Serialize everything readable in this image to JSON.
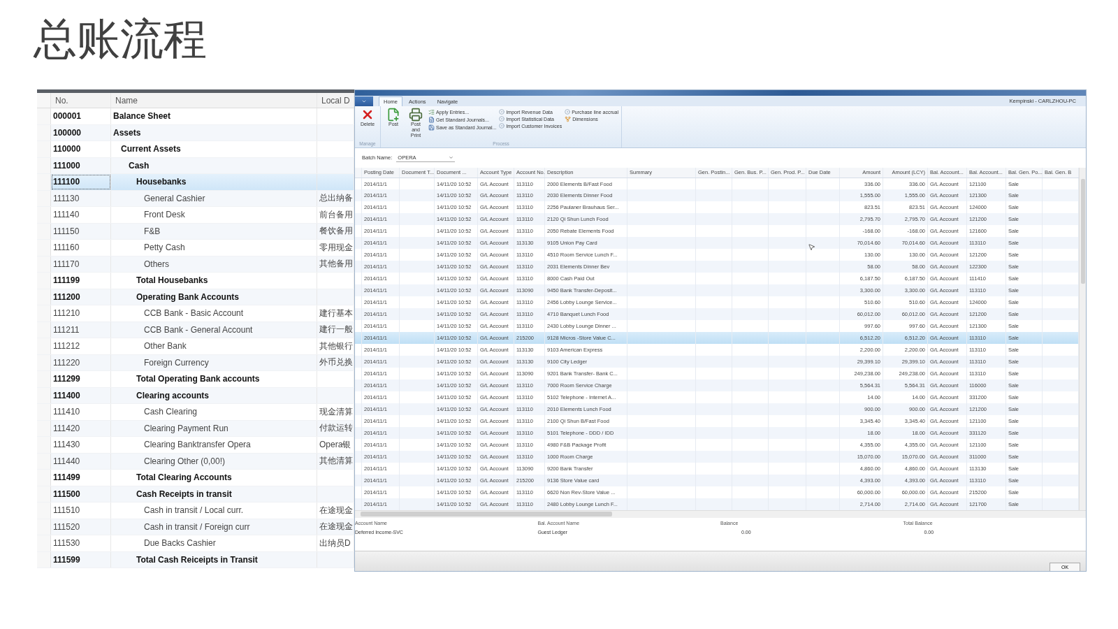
{
  "slide_title": "总账流程",
  "ledger": {
    "columns": [
      "No.",
      "Name",
      "Local D"
    ],
    "accounts": [
      {
        "no": "000001",
        "name": "Balance Sheet",
        "kind": "heading",
        "selected": false
      },
      {
        "no": "100000",
        "name": "Assets",
        "kind": "heading",
        "selected": false,
        "children": [
          {
            "no": "110000",
            "name": "Current Assets",
            "kind": "heading",
            "selected": false,
            "children": [
              {
                "no": "111000",
                "name": "Cash",
                "kind": "heading",
                "selected": false,
                "children": [
                  {
                    "no": "111100",
                    "name": "Housebanks",
                    "kind": "heading",
                    "selected": true,
                    "children": [
                      {
                        "no": "111130",
                        "name": "General Cashier",
                        "local": "总出纳备",
                        "kind": "account",
                        "selected": false
                      },
                      {
                        "no": "111140",
                        "name": "Front Desk",
                        "local": "前台备用",
                        "kind": "account",
                        "selected": false
                      },
                      {
                        "no": "111150",
                        "name": "F&B",
                        "local": "餐饮备用",
                        "kind": "account",
                        "selected": false
                      },
                      {
                        "no": "111160",
                        "name": "Petty Cash",
                        "local": "零用现金",
                        "kind": "account",
                        "selected": false
                      },
                      {
                        "no": "111170",
                        "name": "Others",
                        "local": "其他备用",
                        "kind": "account",
                        "selected": false
                      }
                    ]
                  },
                  {
                    "no": "111199",
                    "name": "Total Housebanks",
                    "kind": "heading",
                    "selected": false
                  },
                  {
                    "no": "111200",
                    "name": "Operating Bank Accounts",
                    "kind": "heading",
                    "selected": false,
                    "children": [
                      {
                        "no": "111210",
                        "name": "CCB Bank - Basic Account",
                        "local": "建行基本",
                        "kind": "account",
                        "selected": false
                      },
                      {
                        "no": "111211",
                        "name": "CCB Bank - General Account",
                        "local": "建行一般",
                        "kind": "account",
                        "selected": false
                      },
                      {
                        "no": "111212",
                        "name": "Other Bank",
                        "local": "其他银行",
                        "kind": "account",
                        "selected": false
                      },
                      {
                        "no": "111220",
                        "name": "Foreign Currency",
                        "local": "外币兑换",
                        "kind": "account",
                        "selected": false
                      }
                    ]
                  },
                  {
                    "no": "111299",
                    "name": "Total Operating Bank accounts",
                    "kind": "heading",
                    "selected": false
                  },
                  {
                    "no": "111400",
                    "name": "Clearing accounts",
                    "kind": "heading",
                    "selected": false,
                    "children": [
                      {
                        "no": "111410",
                        "name": "Cash Clearing",
                        "local": "现金清算",
                        "kind": "account",
                        "selected": false
                      },
                      {
                        "no": "111420",
                        "name": "Clearing Payment Run",
                        "local": "付款运转",
                        "kind": "account",
                        "selected": false
                      },
                      {
                        "no": "111430",
                        "name": "Clearing Banktransfer Opera",
                        "local": "Opera银",
                        "kind": "account",
                        "selected": false
                      },
                      {
                        "no": "111440",
                        "name": "Clearing Other (0,00!)",
                        "local": "其他清算",
                        "kind": "account",
                        "selected": false
                      }
                    ]
                  },
                  {
                    "no": "111499",
                    "name": "Total Clearing Accounts",
                    "kind": "heading",
                    "selected": false
                  },
                  {
                    "no": "111500",
                    "name": "Cash Receipts in transit",
                    "kind": "heading",
                    "selected": false,
                    "children": [
                      {
                        "no": "111510",
                        "name": "Cash in transit / Local curr.",
                        "local": "在途现金",
                        "kind": "account",
                        "selected": false
                      },
                      {
                        "no": "111520",
                        "name": "Cash in transit / Foreign curr",
                        "local": "在途现金",
                        "kind": "account",
                        "selected": false
                      },
                      {
                        "no": "111530",
                        "name": "Due Backs Cashier",
                        "local": "出纳员D",
                        "kind": "account",
                        "selected": false
                      }
                    ]
                  },
                  {
                    "no": "111599",
                    "name": "Total Cash Reiceipts in Transit",
                    "kind": "heading",
                    "selected": false
                  }
                ]
              }
            ]
          }
        ]
      }
    ]
  },
  "journal": {
    "user": "Kempinski - CARLZHOU-PC",
    "tabs": [
      {
        "label": "Home",
        "selected": true
      },
      {
        "label": "Actions",
        "selected": false
      },
      {
        "label": "Navigate",
        "selected": false
      }
    ],
    "groups": [
      {
        "title": "Manage",
        "large": [
          {
            "label": "Delete",
            "kind": "delete"
          }
        ]
      },
      {
        "title": "Process",
        "large": [
          {
            "label": "Post",
            "kind": "post"
          },
          {
            "label": "Post and Print",
            "kind": "print"
          }
        ],
        "columns": [
          [
            {
              "label": "Apply Entries...",
              "kind": "apply"
            },
            {
              "label": "Get Standard Journals...",
              "kind": "journal"
            },
            {
              "label": "Save as Standard Journal...",
              "kind": "save"
            }
          ],
          [
            {
              "label": "Import Revenue Data",
              "kind": "import"
            },
            {
              "label": "Import Statistical Data",
              "kind": "import"
            },
            {
              "label": "Import Customer Invoices",
              "kind": "import"
            }
          ],
          [
            {
              "label": "Purchase line accrual",
              "kind": "import"
            },
            {
              "label": "Dimensions",
              "kind": "dimensions"
            }
          ]
        ]
      }
    ],
    "batch": {
      "label": "Batch Name:",
      "value": "OPERA"
    },
    "grid": {
      "columns": [
        "Posting Date",
        "Document T...",
        "Document ...",
        "Account Type",
        "Account No.",
        "Description",
        "Summary",
        "Gen. Postin...",
        "Gen. Bus. P...",
        "Gen. Prod. P...",
        "Due Date",
        "Amount",
        "Amount (LCY)",
        "Bal. Account...",
        "Bal. Account...",
        "Bal. Gen. Po...",
        "Bal. Gen. B"
      ],
      "rows": [
        {
          "selected": false,
          "posting_date": "2014/11/1",
          "document_date": "14/11/20 10:52",
          "account_type": "G/L Account",
          "account_no": "113110",
          "description": "2000 Elements B/Fast Food",
          "amount": "336.00",
          "amount_lcy": "336.00",
          "bal_account_type": "G/L Account",
          "bal_account_no": "121100",
          "bal_gen_posting": "Sale"
        },
        {
          "selected": false,
          "posting_date": "2014/11/1",
          "document_date": "14/11/20 10:52",
          "account_type": "G/L Account",
          "account_no": "113110",
          "description": "2030 Elements Dinner Food",
          "amount": "1,555.00",
          "amount_lcy": "1,555.00",
          "bal_account_type": "G/L Account",
          "bal_account_no": "121300",
          "bal_gen_posting": "Sale"
        },
        {
          "selected": false,
          "posting_date": "2014/11/1",
          "document_date": "14/11/20 10:52",
          "account_type": "G/L Account",
          "account_no": "113110",
          "description": "2256 Paulaner Brauhaus Ser...",
          "amount": "823.51",
          "amount_lcy": "823.51",
          "bal_account_type": "G/L Account",
          "bal_account_no": "124000",
          "bal_gen_posting": "Sale"
        },
        {
          "selected": false,
          "posting_date": "2014/11/1",
          "document_date": "14/11/20 10:52",
          "account_type": "G/L Account",
          "account_no": "113110",
          "description": "2120 Qi Shun Lunch Food",
          "amount": "2,795.70",
          "amount_lcy": "2,795.70",
          "bal_account_type": "G/L Account",
          "bal_account_no": "121200",
          "bal_gen_posting": "Sale"
        },
        {
          "selected": false,
          "posting_date": "2014/11/1",
          "document_date": "14/11/20 10:52",
          "account_type": "G/L Account",
          "account_no": "113110",
          "description": "2050 Rebate Elements Food",
          "amount": "-168.00",
          "amount_lcy": "-168.00",
          "bal_account_type": "G/L Account",
          "bal_account_no": "121600",
          "bal_gen_posting": "Sale"
        },
        {
          "selected": false,
          "posting_date": "2014/11/1",
          "document_date": "14/11/20 10:52",
          "account_type": "G/L Account",
          "account_no": "113130",
          "description": "9105 Union Pay Card",
          "amount": "70,014.60",
          "amount_lcy": "70,014.60",
          "bal_account_type": "G/L Account",
          "bal_account_no": "113110",
          "bal_gen_posting": "Sale"
        },
        {
          "selected": false,
          "posting_date": "2014/11/1",
          "document_date": "14/11/20 10:52",
          "account_type": "G/L Account",
          "account_no": "113110",
          "description": "4510 Room Service Lunch F...",
          "amount": "130.00",
          "amount_lcy": "130.00",
          "bal_account_type": "G/L Account",
          "bal_account_no": "121200",
          "bal_gen_posting": "Sale"
        },
        {
          "selected": false,
          "posting_date": "2014/11/1",
          "document_date": "14/11/20 10:52",
          "account_type": "G/L Account",
          "account_no": "113110",
          "description": "2031 Elements Dinner Bev",
          "amount": "58.00",
          "amount_lcy": "58.00",
          "bal_account_type": "G/L Account",
          "bal_account_no": "122300",
          "bal_gen_posting": "Sale"
        },
        {
          "selected": false,
          "posting_date": "2014/11/1",
          "document_date": "14/11/20 10:52",
          "account_type": "G/L Account",
          "account_no": "113110",
          "description": "8000 Cash Paid Out",
          "amount": "6,187.50",
          "amount_lcy": "6,187.50",
          "bal_account_type": "G/L Account",
          "bal_account_no": "111410",
          "bal_gen_posting": "Sale"
        },
        {
          "selected": false,
          "posting_date": "2014/11/1",
          "document_date": "14/11/20 10:52",
          "account_type": "G/L Account",
          "account_no": "113090",
          "description": "9450 Bank Transfer-Deposit...",
          "amount": "3,300.00",
          "amount_lcy": "3,300.00",
          "bal_account_type": "G/L Account",
          "bal_account_no": "113110",
          "bal_gen_posting": "Sale"
        },
        {
          "selected": false,
          "posting_date": "2014/11/1",
          "document_date": "14/11/20 10:52",
          "account_type": "G/L Account",
          "account_no": "113110",
          "description": "2456 Lobby Lounge Service...",
          "amount": "510.60",
          "amount_lcy": "510.60",
          "bal_account_type": "G/L Account",
          "bal_account_no": "124000",
          "bal_gen_posting": "Sale"
        },
        {
          "selected": false,
          "posting_date": "2014/11/1",
          "document_date": "14/11/20 10:52",
          "account_type": "G/L Account",
          "account_no": "113110",
          "description": "4710 Banquet Lunch Food",
          "amount": "60,012.00",
          "amount_lcy": "60,012.00",
          "bal_account_type": "G/L Account",
          "bal_account_no": "121200",
          "bal_gen_posting": "Sale"
        },
        {
          "selected": false,
          "posting_date": "2014/11/1",
          "document_date": "14/11/20 10:52",
          "account_type": "G/L Account",
          "account_no": "113110",
          "description": "2430 Lobby Lounge Dinner ...",
          "amount": "997.60",
          "amount_lcy": "997.60",
          "bal_account_type": "G/L Account",
          "bal_account_no": "121300",
          "bal_gen_posting": "Sale"
        },
        {
          "selected": true,
          "posting_date": "2014/11/1",
          "document_date": "14/11/20 10:52",
          "account_type": "G/L Account",
          "account_no": "215200",
          "description": "9128 Micros -Store Value C...",
          "amount": "6,512.20",
          "amount_lcy": "6,512.20",
          "bal_account_type": "G/L Account",
          "bal_account_no": "113110",
          "bal_gen_posting": "Sale"
        },
        {
          "selected": false,
          "posting_date": "2014/11/1",
          "document_date": "14/11/20 10:52",
          "account_type": "G/L Account",
          "account_no": "113130",
          "description": "9103 American Express",
          "amount": "2,200.00",
          "amount_lcy": "2,200.00",
          "bal_account_type": "G/L Account",
          "bal_account_no": "113110",
          "bal_gen_posting": "Sale"
        },
        {
          "selected": false,
          "posting_date": "2014/11/1",
          "document_date": "14/11/20 10:52",
          "account_type": "G/L Account",
          "account_no": "113130",
          "description": "9100 City Ledger",
          "amount": "29,399.10",
          "amount_lcy": "29,399.10",
          "bal_account_type": "G/L Account",
          "bal_account_no": "113110",
          "bal_gen_posting": "Sale"
        },
        {
          "selected": false,
          "posting_date": "2014/11/1",
          "document_date": "14/11/20 10:52",
          "account_type": "G/L Account",
          "account_no": "113090",
          "description": "9201 Bank Transfer- Bank C...",
          "amount": "249,238.00",
          "amount_lcy": "249,238.00",
          "bal_account_type": "G/L Account",
          "bal_account_no": "113110",
          "bal_gen_posting": "Sale"
        },
        {
          "selected": false,
          "posting_date": "2014/11/1",
          "document_date": "14/11/20 10:52",
          "account_type": "G/L Account",
          "account_no": "113110",
          "description": "7000 Room Service Charge",
          "amount": "5,564.31",
          "amount_lcy": "5,564.31",
          "bal_account_type": "G/L Account",
          "bal_account_no": "116000",
          "bal_gen_posting": "Sale"
        },
        {
          "selected": false,
          "posting_date": "2014/11/1",
          "document_date": "14/11/20 10:52",
          "account_type": "G/L Account",
          "account_no": "113110",
          "description": "5102 Telephone - Internet A...",
          "amount": "14.00",
          "amount_lcy": "14.00",
          "bal_account_type": "G/L Account",
          "bal_account_no": "331200",
          "bal_gen_posting": "Sale"
        },
        {
          "selected": false,
          "posting_date": "2014/11/1",
          "document_date": "14/11/20 10:52",
          "account_type": "G/L Account",
          "account_no": "113110",
          "description": "2010 Elements Lunch Food",
          "amount": "900.00",
          "amount_lcy": "900.00",
          "bal_account_type": "G/L Account",
          "bal_account_no": "121200",
          "bal_gen_posting": "Sale"
        },
        {
          "selected": false,
          "posting_date": "2014/11/1",
          "document_date": "14/11/20 10:52",
          "account_type": "G/L Account",
          "account_no": "113110",
          "description": "2100 Qi Shun B/Fast Food",
          "amount": "3,345.40",
          "amount_lcy": "3,345.40",
          "bal_account_type": "G/L Account",
          "bal_account_no": "121100",
          "bal_gen_posting": "Sale"
        },
        {
          "selected": false,
          "posting_date": "2014/11/1",
          "document_date": "14/11/20 10:52",
          "account_type": "G/L Account",
          "account_no": "113110",
          "description": "5101 Telephone - DDD / IDD",
          "amount": "18.00",
          "amount_lcy": "18.00",
          "bal_account_type": "G/L Account",
          "bal_account_no": "331120",
          "bal_gen_posting": "Sale"
        },
        {
          "selected": false,
          "posting_date": "2014/11/1",
          "document_date": "14/11/20 10:52",
          "account_type": "G/L Account",
          "account_no": "113110",
          "description": "4980 F&B Package Profit",
          "amount": "4,355.00",
          "amount_lcy": "4,355.00",
          "bal_account_type": "G/L Account",
          "bal_account_no": "121100",
          "bal_gen_posting": "Sale"
        },
        {
          "selected": false,
          "posting_date": "2014/11/1",
          "document_date": "14/11/20 10:52",
          "account_type": "G/L Account",
          "account_no": "113110",
          "description": "1000 Room Charge",
          "amount": "15,070.00",
          "amount_lcy": "15,070.00",
          "bal_account_type": "G/L Account",
          "bal_account_no": "311000",
          "bal_gen_posting": "Sale"
        },
        {
          "selected": false,
          "posting_date": "2014/11/1",
          "document_date": "14/11/20 10:52",
          "account_type": "G/L Account",
          "account_no": "113090",
          "description": "9200 Bank Transfer",
          "amount": "4,860.00",
          "amount_lcy": "4,860.00",
          "bal_account_type": "G/L Account",
          "bal_account_no": "113130",
          "bal_gen_posting": "Sale"
        },
        {
          "selected": false,
          "posting_date": "2014/11/1",
          "document_date": "14/11/20 10:52",
          "account_type": "G/L Account",
          "account_no": "215200",
          "description": "9136 Store Value card",
          "amount": "4,393.00",
          "amount_lcy": "4,393.00",
          "bal_account_type": "G/L Account",
          "bal_account_no": "113110",
          "bal_gen_posting": "Sale"
        },
        {
          "selected": false,
          "posting_date": "2014/11/1",
          "document_date": "14/11/20 10:52",
          "account_type": "G/L Account",
          "account_no": "113110",
          "description": "6620 Non Rev-Store Value ...",
          "amount": "60,000.00",
          "amount_lcy": "60,000.00",
          "bal_account_type": "G/L Account",
          "bal_account_no": "215200",
          "bal_gen_posting": "Sale"
        },
        {
          "selected": false,
          "posting_date": "2014/11/1",
          "document_date": "14/11/20 10:52",
          "account_type": "G/L Account",
          "account_no": "113110",
          "description": "2480 Lobby Lounge Lunch F...",
          "amount": "2,714.00",
          "amount_lcy": "2,714.00",
          "bal_account_type": "G/L Account",
          "bal_account_no": "121700",
          "bal_gen_posting": "Sale"
        }
      ]
    },
    "footer": [
      {
        "label": "Account Name",
        "value": "Deferred Income-SVC",
        "kind": "text"
      },
      {
        "label": "Bal. Account Name",
        "value": "Guest Ledger",
        "kind": "text"
      },
      {
        "label": "Balance",
        "value": "0.00",
        "kind": "number"
      },
      {
        "label": "Total Balance",
        "value": "0.00",
        "kind": "number"
      }
    ],
    "ok_button": "OK"
  }
}
